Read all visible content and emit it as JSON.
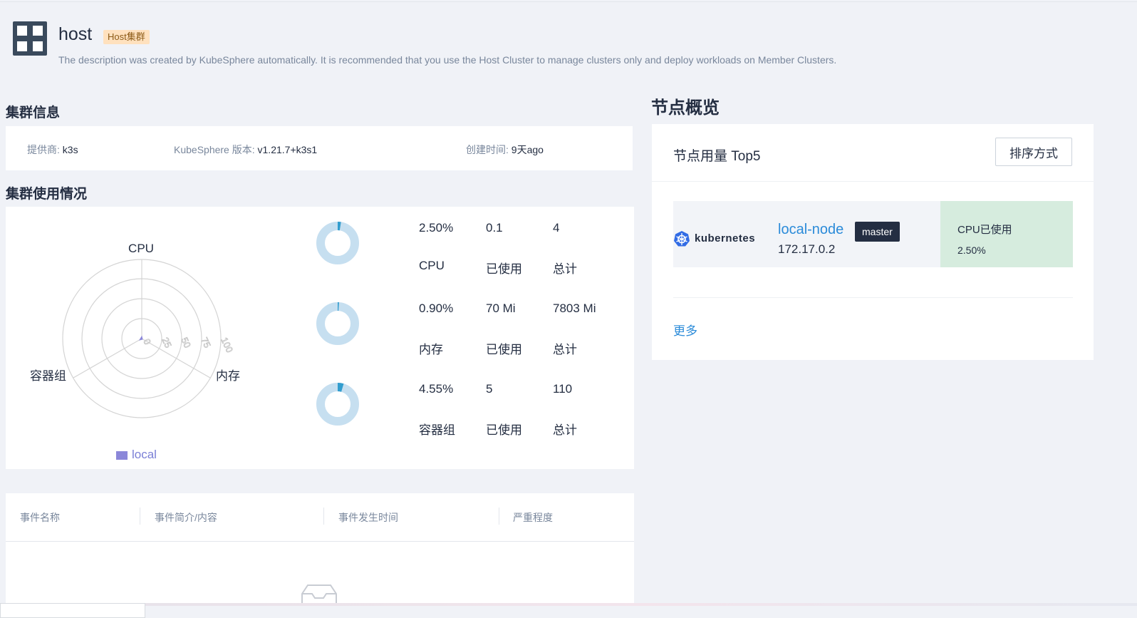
{
  "header": {
    "title": "host",
    "tag": "Host集群",
    "description": "The description was created by KubeSphere automatically. It is recommended that you use the Host Cluster to manage clusters only and deploy workloads on Member Clusters."
  },
  "cluster_info": {
    "section_title": "集群信息",
    "provider_label": "提供商:",
    "provider_value": "k3s",
    "version_label": "KubeSphere 版本:",
    "version_value": "v1.21.7+k3s1",
    "created_label": "创建时间:",
    "created_value": "9天ago"
  },
  "cluster_usage": {
    "section_title": "集群使用情况",
    "legend": "local",
    "radar_axes": [
      "CPU",
      "内存",
      "容器组"
    ],
    "radar_ticks": [
      "0",
      "25",
      "50",
      "75",
      "100"
    ],
    "metrics": [
      {
        "percent": "2.50%",
        "used": "0.1",
        "total": "4",
        "name": "CPU",
        "used_label": "已使用",
        "total_label": "总计",
        "fraction": 0.025
      },
      {
        "percent": "0.90%",
        "used": "70 Mi",
        "total": "7803 Mi",
        "name": "内存",
        "used_label": "已使用",
        "total_label": "总计",
        "fraction": 0.009
      },
      {
        "percent": "4.55%",
        "used": "5",
        "total": "110",
        "name": "容器组",
        "used_label": "已使用",
        "total_label": "总计",
        "fraction": 0.0455
      }
    ]
  },
  "events": {
    "columns": [
      "事件名称",
      "事件简介/内容",
      "事件发生时间",
      "严重程度"
    ]
  },
  "node_overview": {
    "section_title": "节点概览",
    "card_title": "节点用量 Top5",
    "sort_button": "排序方式",
    "node": {
      "logo_text": "kubernetes",
      "name": "local-node",
      "role": "master",
      "ip": "172.17.0.2",
      "metric_label": "CPU已使用",
      "metric_value": "2.50%"
    },
    "more": "更多"
  },
  "colors": {
    "accent": "#2b8bd9",
    "donut_track": "#c6dff0",
    "donut_fill": "#329dce",
    "radar_series": "#8b87d9",
    "tag_bg": "#ffe1be",
    "cpu_cell_bg": "#d6ecde"
  }
}
